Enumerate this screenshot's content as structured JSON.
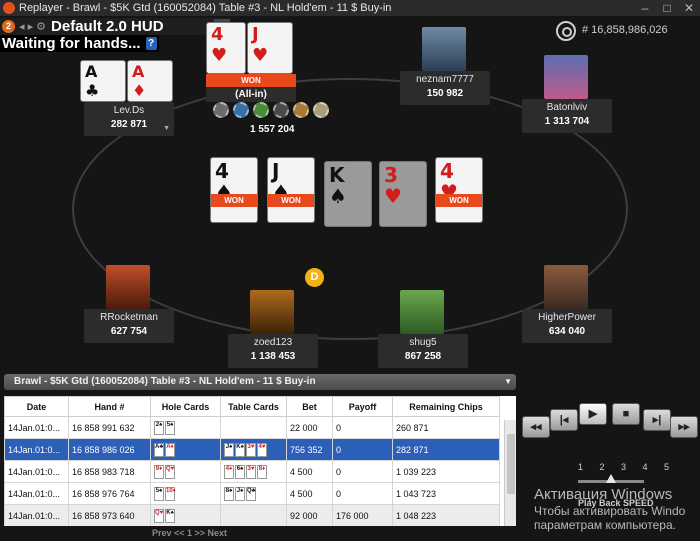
{
  "window": {
    "title": "Replayer - Brawl - $5K Gtd (160052084) Table #3 -  NL  Hold'em - 11 $ Buy-in",
    "min": "–",
    "max": "□",
    "close": "✕"
  },
  "hud": {
    "badge": "2",
    "controls": "◂ ▸ ⚙",
    "name": "Default 2.0 HUD",
    "waiting": "Waiting for hands...",
    "help": "?"
  },
  "hand_number": "# 16,858,986,026",
  "pot": "1 557 204",
  "dealer": "D",
  "seats": [
    {
      "name": "Lev.Ds",
      "stack": "282 871"
    },
    {
      "name": "neznam7777",
      "stack": "150 982"
    },
    {
      "name": "Batonlviv",
      "stack": "1 313 704"
    },
    {
      "name": "HigherPower",
      "stack": "634 040"
    },
    {
      "name": "shug5",
      "stack": "867 258"
    },
    {
      "name": "zoed123",
      "stack": "1 138 453"
    },
    {
      "name": "RRocketman",
      "stack": "627 754"
    }
  ],
  "hero_action": {
    "won": "WON",
    "status": "(All-in)"
  },
  "hole_cards": {
    "left": [
      {
        "rank": "A",
        "suit": "♣"
      },
      {
        "rank": "A",
        "suit": "♦"
      }
    ],
    "top": [
      {
        "rank": "4",
        "suit": "♥"
      },
      {
        "rank": "J",
        "suit": "♥"
      }
    ]
  },
  "board": [
    {
      "rank": "4",
      "suit": "♠",
      "won": "WON"
    },
    {
      "rank": "J",
      "suit": "♠",
      "won": "WON"
    },
    {
      "rank": "K",
      "suit": "♠",
      "won": ""
    },
    {
      "rank": "3",
      "suit": "♥",
      "won": ""
    },
    {
      "rank": "4",
      "suit": "♥",
      "won": "WON"
    }
  ],
  "history": {
    "header": "Brawl - $5K Gtd (160052084) Table #3 -  NL  Hold'em - 11 $ Buy-in",
    "columns": [
      "Date",
      "Hand #",
      "Hole Cards",
      "Table Cards",
      "Bet",
      "Payoff",
      "Remaining Chips"
    ],
    "rows": [
      {
        "date": "14Jan.01:0...",
        "hand": "16 858 991 632",
        "hole": [
          "2♠",
          "5♠"
        ],
        "table": [],
        "bet": "22 000",
        "payoff": "0",
        "remaining": "260 871"
      },
      {
        "date": "14Jan.01:0...",
        "hand": "16 858 986 026",
        "hole": [
          "A♣",
          "A♦"
        ],
        "table": [
          "J♠",
          "K♠",
          "3♥",
          "4♥"
        ],
        "bet": "756 352",
        "payoff": "0",
        "remaining": "282 871"
      },
      {
        "date": "14Jan.01:0...",
        "hand": "16 858 983 718",
        "hole": [
          "9♦",
          "Q♥"
        ],
        "table": [
          "4♦",
          "6♠",
          "3♥",
          "8♦"
        ],
        "bet": "4 500",
        "payoff": "0",
        "remaining": "1 039 223"
      },
      {
        "date": "14Jan.01:0...",
        "hand": "16 858 976 764",
        "hole": [
          "5♠",
          "10♦"
        ],
        "table": [
          "8♠",
          "J♠",
          "Q♣"
        ],
        "bet": "4 500",
        "payoff": "0",
        "remaining": "1 043 723"
      },
      {
        "date": "14Jan.01:0...",
        "hand": "16 858 973 640",
        "hole": [
          "Q♥",
          "K♠"
        ],
        "table": [],
        "bet": "92 000",
        "payoff": "176 000",
        "remaining": "1 048 223"
      }
    ],
    "pager": "Prev <<   1 >> Next"
  },
  "player_controls": {
    "buttons": [
      "◂◂",
      "|◂",
      "▶",
      "■",
      "▸|",
      "▸▸"
    ],
    "speed_scale": "1 2 3 4 5",
    "speed_label": "Play Back SPEED",
    "speed_value": 3
  },
  "activation": {
    "line1": "Активация Windows",
    "line2": "Чтобы активировать Windo",
    "line3": "параметрам компьютера."
  }
}
